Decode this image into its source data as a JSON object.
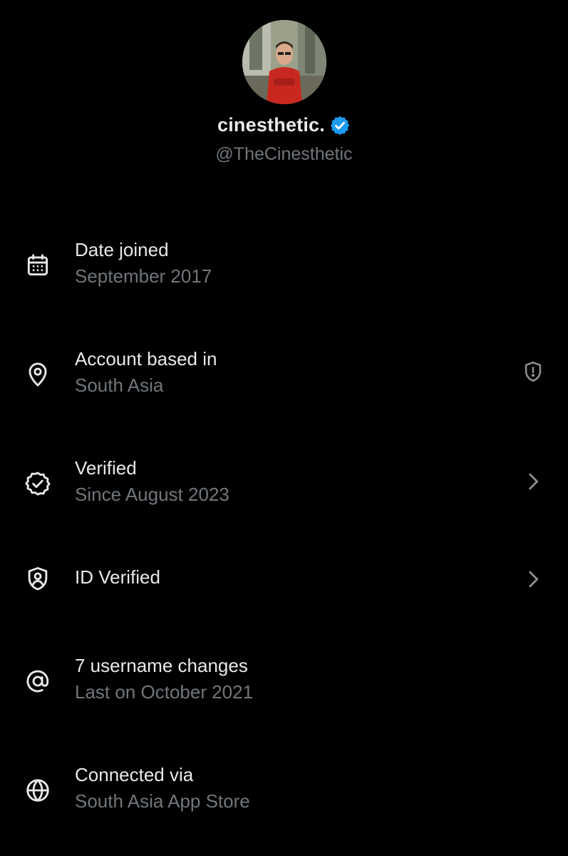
{
  "profile": {
    "display_name": "cinesthetic.",
    "handle": "@TheCinesthetic",
    "verified_badge_icon": "verified-badge-icon",
    "badge_color": "#1d9bf0"
  },
  "rows": [
    {
      "icon": "calendar-icon",
      "title": "Date joined",
      "subtitle": "September 2017"
    },
    {
      "icon": "location-pin-icon",
      "title": "Account based in",
      "subtitle": "South Asia",
      "trailing_icon": "shield-alert-icon"
    },
    {
      "icon": "verified-badge-outline-icon",
      "title": "Verified",
      "subtitle": "Since August 2023",
      "trailing_icon": "chevron-right-icon"
    },
    {
      "icon": "id-shield-icon",
      "title": "ID Verified",
      "trailing_icon": "chevron-right-icon"
    },
    {
      "icon": "at-sign-icon",
      "title": "7 username changes",
      "subtitle": "Last on October 2021"
    },
    {
      "icon": "globe-icon",
      "title": "Connected via",
      "subtitle": "South Asia App Store"
    }
  ],
  "colors": {
    "background": "#000000",
    "primary_text": "#e7e9ea",
    "secondary_text": "#71767b"
  }
}
